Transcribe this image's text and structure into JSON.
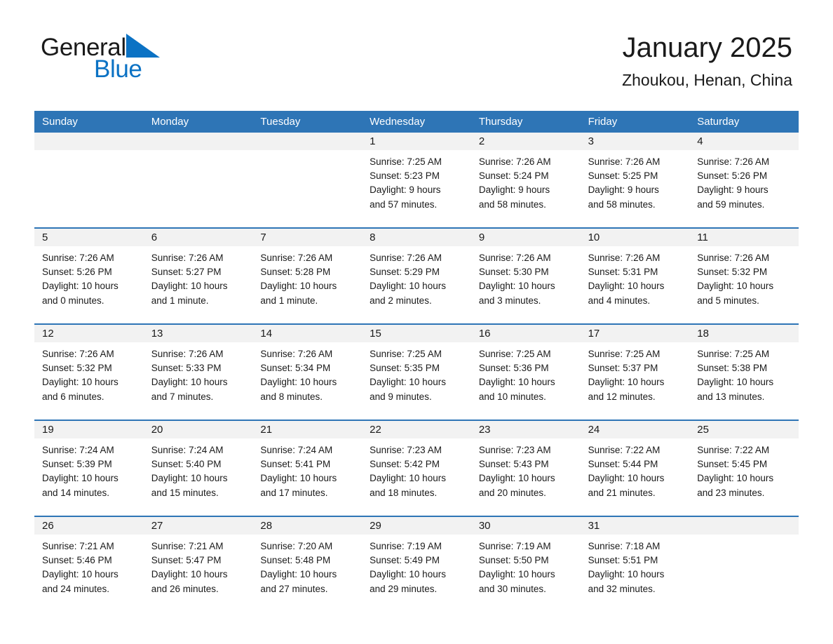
{
  "brand": {
    "name_part1": "General",
    "name_part2": "Blue",
    "triangle_color": "#0b72c4"
  },
  "header": {
    "title": "January 2025",
    "location": "Zhoukou, Henan, China"
  },
  "theme": {
    "header_blue": "#2e75b6",
    "row_band_gray": "#f2f2f2",
    "text": "#1a1a1a"
  },
  "weekdays": [
    "Sunday",
    "Monday",
    "Tuesday",
    "Wednesday",
    "Thursday",
    "Friday",
    "Saturday"
  ],
  "weeks": [
    [
      {
        "day": "",
        "sunrise": "",
        "sunset": "",
        "daylight_line1": "",
        "daylight_line2": ""
      },
      {
        "day": "",
        "sunrise": "",
        "sunset": "",
        "daylight_line1": "",
        "daylight_line2": ""
      },
      {
        "day": "",
        "sunrise": "",
        "sunset": "",
        "daylight_line1": "",
        "daylight_line2": ""
      },
      {
        "day": "1",
        "sunrise": "Sunrise: 7:25 AM",
        "sunset": "Sunset: 5:23 PM",
        "daylight_line1": "Daylight: 9 hours",
        "daylight_line2": "and 57 minutes."
      },
      {
        "day": "2",
        "sunrise": "Sunrise: 7:26 AM",
        "sunset": "Sunset: 5:24 PM",
        "daylight_line1": "Daylight: 9 hours",
        "daylight_line2": "and 58 minutes."
      },
      {
        "day": "3",
        "sunrise": "Sunrise: 7:26 AM",
        "sunset": "Sunset: 5:25 PM",
        "daylight_line1": "Daylight: 9 hours",
        "daylight_line2": "and 58 minutes."
      },
      {
        "day": "4",
        "sunrise": "Sunrise: 7:26 AM",
        "sunset": "Sunset: 5:26 PM",
        "daylight_line1": "Daylight: 9 hours",
        "daylight_line2": "and 59 minutes."
      }
    ],
    [
      {
        "day": "5",
        "sunrise": "Sunrise: 7:26 AM",
        "sunset": "Sunset: 5:26 PM",
        "daylight_line1": "Daylight: 10 hours",
        "daylight_line2": "and 0 minutes."
      },
      {
        "day": "6",
        "sunrise": "Sunrise: 7:26 AM",
        "sunset": "Sunset: 5:27 PM",
        "daylight_line1": "Daylight: 10 hours",
        "daylight_line2": "and 1 minute."
      },
      {
        "day": "7",
        "sunrise": "Sunrise: 7:26 AM",
        "sunset": "Sunset: 5:28 PM",
        "daylight_line1": "Daylight: 10 hours",
        "daylight_line2": "and 1 minute."
      },
      {
        "day": "8",
        "sunrise": "Sunrise: 7:26 AM",
        "sunset": "Sunset: 5:29 PM",
        "daylight_line1": "Daylight: 10 hours",
        "daylight_line2": "and 2 minutes."
      },
      {
        "day": "9",
        "sunrise": "Sunrise: 7:26 AM",
        "sunset": "Sunset: 5:30 PM",
        "daylight_line1": "Daylight: 10 hours",
        "daylight_line2": "and 3 minutes."
      },
      {
        "day": "10",
        "sunrise": "Sunrise: 7:26 AM",
        "sunset": "Sunset: 5:31 PM",
        "daylight_line1": "Daylight: 10 hours",
        "daylight_line2": "and 4 minutes."
      },
      {
        "day": "11",
        "sunrise": "Sunrise: 7:26 AM",
        "sunset": "Sunset: 5:32 PM",
        "daylight_line1": "Daylight: 10 hours",
        "daylight_line2": "and 5 minutes."
      }
    ],
    [
      {
        "day": "12",
        "sunrise": "Sunrise: 7:26 AM",
        "sunset": "Sunset: 5:32 PM",
        "daylight_line1": "Daylight: 10 hours",
        "daylight_line2": "and 6 minutes."
      },
      {
        "day": "13",
        "sunrise": "Sunrise: 7:26 AM",
        "sunset": "Sunset: 5:33 PM",
        "daylight_line1": "Daylight: 10 hours",
        "daylight_line2": "and 7 minutes."
      },
      {
        "day": "14",
        "sunrise": "Sunrise: 7:26 AM",
        "sunset": "Sunset: 5:34 PM",
        "daylight_line1": "Daylight: 10 hours",
        "daylight_line2": "and 8 minutes."
      },
      {
        "day": "15",
        "sunrise": "Sunrise: 7:25 AM",
        "sunset": "Sunset: 5:35 PM",
        "daylight_line1": "Daylight: 10 hours",
        "daylight_line2": "and 9 minutes."
      },
      {
        "day": "16",
        "sunrise": "Sunrise: 7:25 AM",
        "sunset": "Sunset: 5:36 PM",
        "daylight_line1": "Daylight: 10 hours",
        "daylight_line2": "and 10 minutes."
      },
      {
        "day": "17",
        "sunrise": "Sunrise: 7:25 AM",
        "sunset": "Sunset: 5:37 PM",
        "daylight_line1": "Daylight: 10 hours",
        "daylight_line2": "and 12 minutes."
      },
      {
        "day": "18",
        "sunrise": "Sunrise: 7:25 AM",
        "sunset": "Sunset: 5:38 PM",
        "daylight_line1": "Daylight: 10 hours",
        "daylight_line2": "and 13 minutes."
      }
    ],
    [
      {
        "day": "19",
        "sunrise": "Sunrise: 7:24 AM",
        "sunset": "Sunset: 5:39 PM",
        "daylight_line1": "Daylight: 10 hours",
        "daylight_line2": "and 14 minutes."
      },
      {
        "day": "20",
        "sunrise": "Sunrise: 7:24 AM",
        "sunset": "Sunset: 5:40 PM",
        "daylight_line1": "Daylight: 10 hours",
        "daylight_line2": "and 15 minutes."
      },
      {
        "day": "21",
        "sunrise": "Sunrise: 7:24 AM",
        "sunset": "Sunset: 5:41 PM",
        "daylight_line1": "Daylight: 10 hours",
        "daylight_line2": "and 17 minutes."
      },
      {
        "day": "22",
        "sunrise": "Sunrise: 7:23 AM",
        "sunset": "Sunset: 5:42 PM",
        "daylight_line1": "Daylight: 10 hours",
        "daylight_line2": "and 18 minutes."
      },
      {
        "day": "23",
        "sunrise": "Sunrise: 7:23 AM",
        "sunset": "Sunset: 5:43 PM",
        "daylight_line1": "Daylight: 10 hours",
        "daylight_line2": "and 20 minutes."
      },
      {
        "day": "24",
        "sunrise": "Sunrise: 7:22 AM",
        "sunset": "Sunset: 5:44 PM",
        "daylight_line1": "Daylight: 10 hours",
        "daylight_line2": "and 21 minutes."
      },
      {
        "day": "25",
        "sunrise": "Sunrise: 7:22 AM",
        "sunset": "Sunset: 5:45 PM",
        "daylight_line1": "Daylight: 10 hours",
        "daylight_line2": "and 23 minutes."
      }
    ],
    [
      {
        "day": "26",
        "sunrise": "Sunrise: 7:21 AM",
        "sunset": "Sunset: 5:46 PM",
        "daylight_line1": "Daylight: 10 hours",
        "daylight_line2": "and 24 minutes."
      },
      {
        "day": "27",
        "sunrise": "Sunrise: 7:21 AM",
        "sunset": "Sunset: 5:47 PM",
        "daylight_line1": "Daylight: 10 hours",
        "daylight_line2": "and 26 minutes."
      },
      {
        "day": "28",
        "sunrise": "Sunrise: 7:20 AM",
        "sunset": "Sunset: 5:48 PM",
        "daylight_line1": "Daylight: 10 hours",
        "daylight_line2": "and 27 minutes."
      },
      {
        "day": "29",
        "sunrise": "Sunrise: 7:19 AM",
        "sunset": "Sunset: 5:49 PM",
        "daylight_line1": "Daylight: 10 hours",
        "daylight_line2": "and 29 minutes."
      },
      {
        "day": "30",
        "sunrise": "Sunrise: 7:19 AM",
        "sunset": "Sunset: 5:50 PM",
        "daylight_line1": "Daylight: 10 hours",
        "daylight_line2": "and 30 minutes."
      },
      {
        "day": "31",
        "sunrise": "Sunrise: 7:18 AM",
        "sunset": "Sunset: 5:51 PM",
        "daylight_line1": "Daylight: 10 hours",
        "daylight_line2": "and 32 minutes."
      },
      {
        "day": "",
        "sunrise": "",
        "sunset": "",
        "daylight_line1": "",
        "daylight_line2": ""
      }
    ]
  ]
}
